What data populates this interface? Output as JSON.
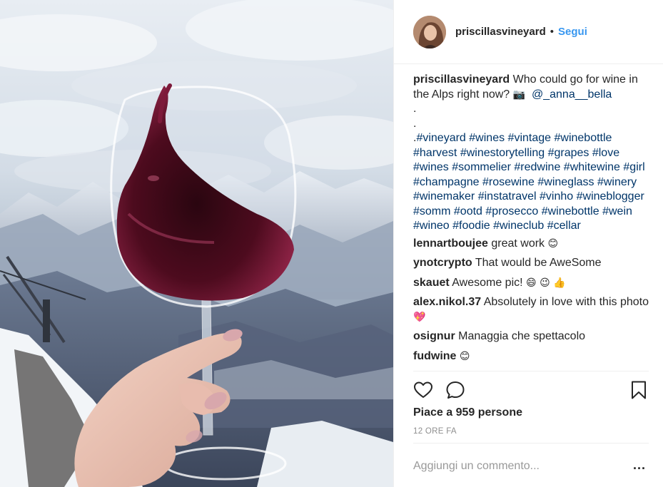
{
  "post": {
    "username": "priscillasvineyard",
    "separator": "•",
    "follow_label": "Segui",
    "image_alt": "Wine glass with red wine in front of snowy Alps"
  },
  "caption": {
    "username": "priscillasvineyard",
    "text": "Who could go for wine in the Alps right now?",
    "camera_emoji": "📷",
    "mention": "@_anna__bella",
    "dot1": ".",
    "dot2": ".",
    "prefix": ".",
    "hashtags": [
      "#vineyard",
      "#wines",
      "#vintage",
      "#winebottle",
      "#harvest",
      "#winestorytelling",
      "#grapes",
      "#love",
      "#wines",
      "#sommelier",
      "#redwine",
      "#whitewine",
      "#girl",
      "#champagne",
      "#rosewine",
      "#wineglass",
      "#winery",
      "#winemaker",
      "#instatravel",
      "#vinho",
      "#wineblogger",
      "#somm",
      "#ootd",
      "#prosecco",
      "#winebottle",
      "#wein",
      "#wineo",
      "#foodie",
      "#wineclub",
      "#cellar"
    ]
  },
  "comments": [
    {
      "user": "lennartboujee",
      "text": "great work",
      "emoji": "😊"
    },
    {
      "user": "ynotcrypto",
      "text": "That would be AweSome",
      "emoji": ""
    },
    {
      "user": "skauet",
      "text": "Awesome pic!",
      "emoji": "😄 😉 👍"
    },
    {
      "user": "alex.nikol.37",
      "text": "Absolutely in love with this photo",
      "emoji": "💖"
    },
    {
      "user": "osignur",
      "text": "Managgia che spettacolo",
      "emoji": ""
    },
    {
      "user": "fudwine",
      "text": "",
      "emoji": "😊"
    }
  ],
  "actions": {
    "like_icon": "heart-icon",
    "comment_icon": "comment-icon",
    "save_icon": "bookmark-icon"
  },
  "likes_text": "Piace a 959 persone",
  "time_text": "12 ORE FA",
  "add_comment": {
    "placeholder": "Aggiungi un commento...",
    "more_label": "..."
  },
  "colors": {
    "link": "#003569",
    "follow": "#3897f0",
    "muted": "#8e8e8e",
    "wine": "#5a0d1f"
  }
}
